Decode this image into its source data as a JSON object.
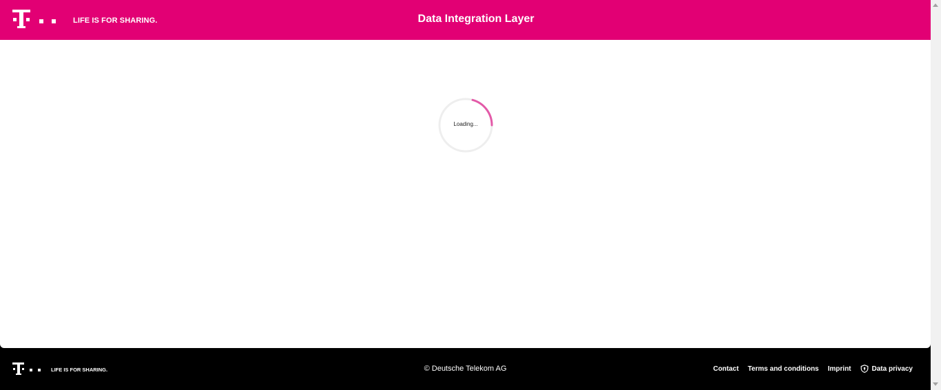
{
  "header": {
    "tagline": "LIFE IS FOR SHARING.",
    "title": "Data Integration Layer",
    "brand_color": "#e20074"
  },
  "main": {
    "loading_text": "Loading...",
    "spinner_color": "#e20074",
    "spinner_track_color": "#eeeeee"
  },
  "footer": {
    "tagline": "LIFE IS FOR SHARING.",
    "copyright": "© Deutsche Telekom AG",
    "links": [
      {
        "label": "Contact"
      },
      {
        "label": "Terms and conditions"
      },
      {
        "label": "Imprint"
      },
      {
        "label": "Data privacy",
        "icon": "shield-icon"
      }
    ]
  }
}
